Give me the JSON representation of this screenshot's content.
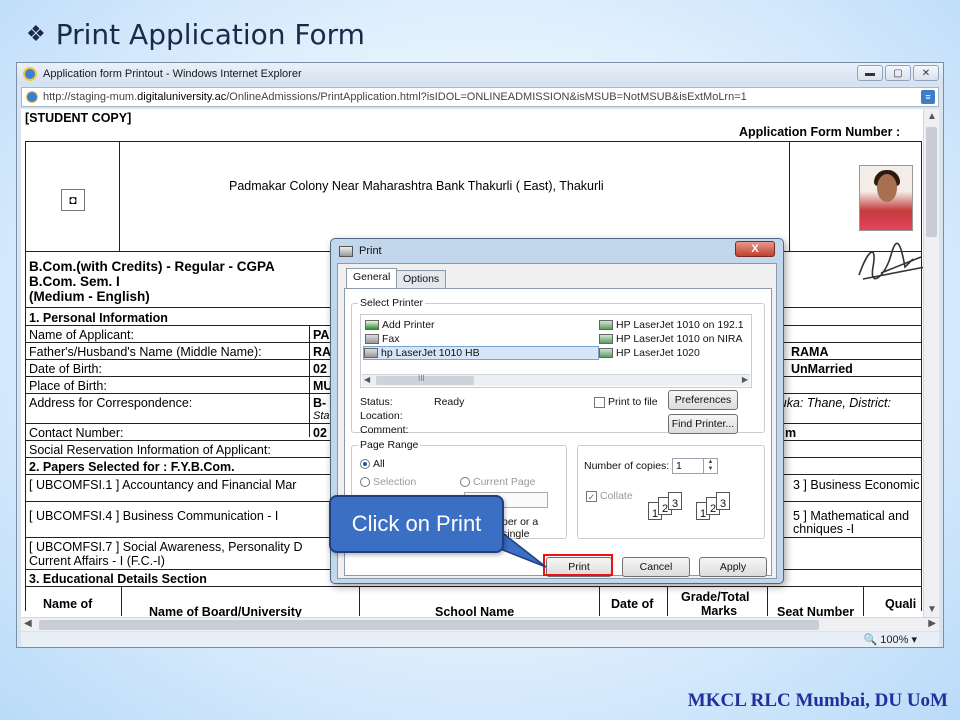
{
  "slide": {
    "title": "Print Application Form",
    "bullet": "❖",
    "footer": "MKCL RLC Mumbai, DU UoM"
  },
  "browser": {
    "window_title": "Application form Printout - Windows Internet Explorer",
    "url_prefix": "http://staging-mum.",
    "url_domain": "digitaluniversity.ac",
    "url_rest": "/OnlineAdmissions/PrintApplication.html?isIDOL=ONLINEADMISSION&isMSUB=NotMSUB&isExtMoLrn=1",
    "zoom": "100%"
  },
  "form": {
    "copy_label": "[STUDENT COPY]",
    "app_number_label": "Application Form Number :",
    "address_header": "Padmakar Colony Near Maharashtra Bank Thakurli ( East), Thakurli",
    "course_line1": "B.Com.(with Credits) - Regular - CGPA",
    "course_line2": "B.Com. Sem. I",
    "course_line3": "(Medium - English)",
    "section_personal": "1. Personal Information",
    "rows": [
      {
        "label": "Name of Applicant:",
        "value": "PA"
      },
      {
        "label": "Father's/Husband's Name (Middle Name):",
        "value": "RA"
      },
      {
        "label": "Date of Birth:",
        "value": "02"
      },
      {
        "label": "Place of Birth:",
        "value": "MU"
      },
      {
        "label": "Address for Correspondence:",
        "value": "B-"
      },
      {
        "label": "Contact Number:",
        "value": "02"
      }
    ],
    "address_value_line2": "Sta",
    "right_values": {
      "father_right": "RAMA",
      "dob_right": "UnMarried",
      "address_right": "luka: Thane, District:",
      "contact_right": "m"
    },
    "social_reservation": "Social Reservation Information of Applicant:",
    "section_papers": "2. Papers Selected for : F.Y.B.Com.",
    "papers": [
      "[ UBCOMFSI.1 ] Accountancy and Financial Mar",
      "[ UBCOMFSI.4 ] Business Communication - I",
      "[ UBCOMFSI.7 ] Social Awareness, Personality D",
      "Current Affairs - I (F.C.-I)"
    ],
    "papers_right": [
      "3 ] Business Economic",
      "5 ] Mathematical and",
      "chniques -I"
    ],
    "section_education": "3. Educational Details Section",
    "edu_headers": [
      "Name of",
      "Name of Board/University",
      "School Name",
      "Date of",
      "Grade/Total",
      "Marks",
      "Seat Number",
      "Quali"
    ]
  },
  "dialog": {
    "title": "Print",
    "close": "X",
    "tabs": [
      "General",
      "Options"
    ],
    "select_printer_label": "Select Printer",
    "printers_left": [
      "Add Printer",
      "Fax",
      "hp LaserJet 1010 HB"
    ],
    "printers_right": [
      "HP LaserJet 1010 on 192.1",
      "HP LaserJet 1010 on NIRA",
      "HP LaserJet 1020"
    ],
    "list_scroll_marker": "III",
    "status_label": "Status:",
    "status_value": "Ready",
    "location_label": "Location:",
    "comment_label": "Comment:",
    "print_to_file": "Print to file",
    "preferences": "Preferences",
    "find_printer": "Find Printer...",
    "page_range_label": "Page Range",
    "range_all": "All",
    "range_selection": "Selection",
    "range_current": "Current Page",
    "range_partial": "per or a single",
    "copies_label": "Number of copies:",
    "copies_value": "1",
    "collate": "Collate",
    "collate_pages": [
      "1",
      "2",
      "3"
    ],
    "buttons": {
      "print": "Print",
      "cancel": "Cancel",
      "apply": "Apply"
    }
  },
  "callout": "Click on Print"
}
